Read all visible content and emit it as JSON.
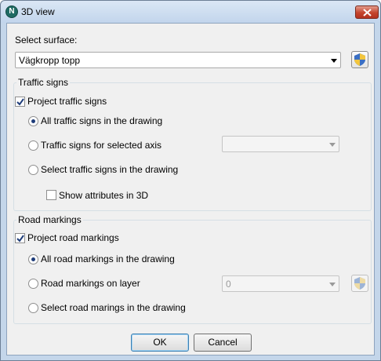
{
  "window": {
    "title": "3D view",
    "app_icon_letter": "N"
  },
  "surface": {
    "label": "Select surface:",
    "value": "Vägkropp topp"
  },
  "traffic_signs": {
    "group_title": "Traffic signs",
    "project_label": "Project traffic signs",
    "project_checked": true,
    "option_all": "All traffic signs in the drawing",
    "option_axis": "Traffic signs for selected axis",
    "option_select": "Select traffic signs in the drawing",
    "axis_value": "",
    "show_attributes_label": "Show attributes in 3D",
    "show_attributes_checked": false,
    "selected_option": "all"
  },
  "road_markings": {
    "group_title": "Road markings",
    "project_label": "Project road markings",
    "project_checked": true,
    "option_all": "All road markings in the drawing",
    "option_layer": "Road markings on layer",
    "option_select": "Select road marings in the drawing",
    "layer_value": "0",
    "selected_option": "all"
  },
  "buttons": {
    "ok": "OK",
    "cancel": "Cancel"
  },
  "colors": {
    "accent": "#1f3d7a",
    "close_red": "#c4442d",
    "titlebar": "#c4d6ea"
  }
}
